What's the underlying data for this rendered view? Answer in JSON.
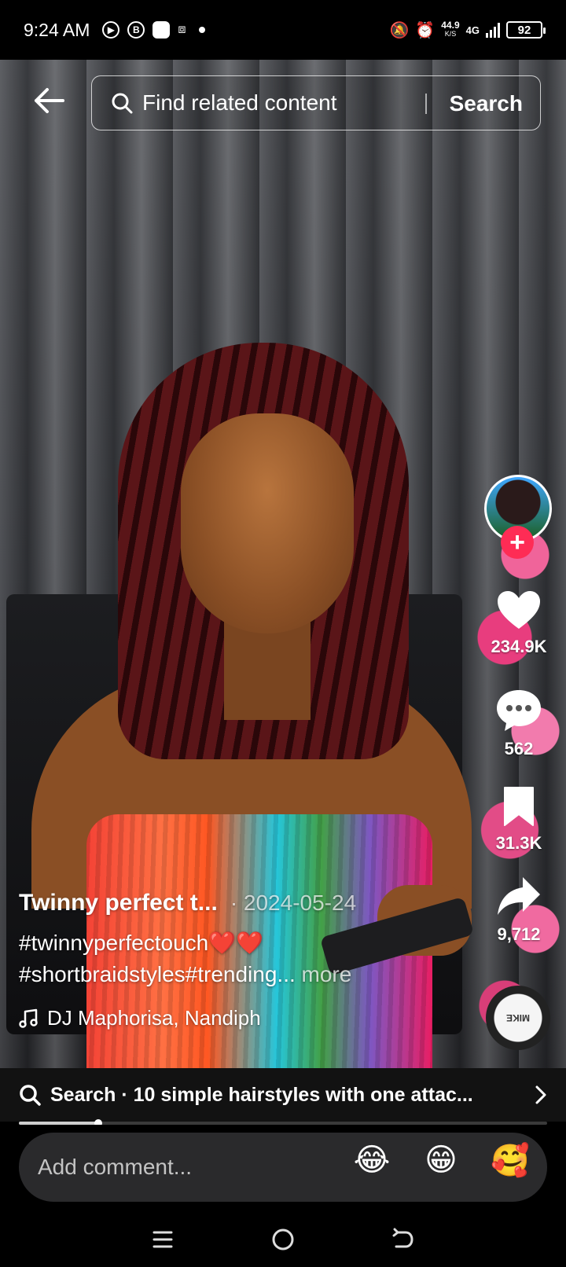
{
  "status_bar": {
    "time": "9:24 AM",
    "net_speed": "44.9",
    "net_speed_unit": "K/S",
    "network": "4G",
    "battery": "92"
  },
  "top_bar": {
    "search_placeholder": "Find related content",
    "search_button": "Search"
  },
  "actions": {
    "likes": "234.9K",
    "comments": "562",
    "saves": "31.3K",
    "shares": "9,712"
  },
  "caption": {
    "title": "Twinny perfect t...",
    "date": "· 2024-05-24",
    "hashtags_line1": "#twinnyperfectouch❤️❤️",
    "hashtags_line2": "#shortbraidstyles#trending...",
    "more": "more",
    "sound": "DJ Maphorisa, Nandiph"
  },
  "music_disc_label": "MIKE",
  "related_search": {
    "text": "Search · 10 simple hairstyles with one attac..."
  },
  "playback": {
    "progress_fraction": 0.15
  },
  "comment_bar": {
    "placeholder": "Add comment...",
    "emojis": [
      "😂",
      "😁",
      "🥰"
    ]
  },
  "colors": {
    "accent": "#fe2c55",
    "like_heart": "#ffffff"
  }
}
